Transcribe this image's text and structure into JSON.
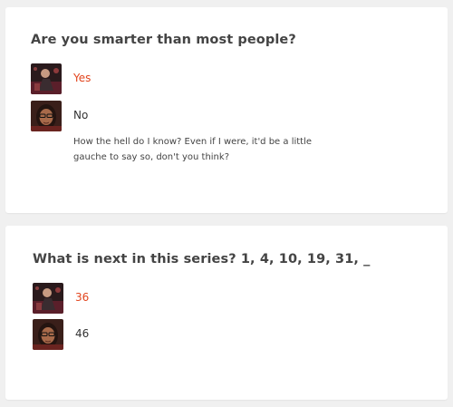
{
  "questions": [
    {
      "question": "Are you smarter than most people?",
      "answers": [
        {
          "avatar": "performer-avatar-icon",
          "text": "Yes",
          "selected": true
        },
        {
          "avatar": "woman-glasses-avatar-icon",
          "text": "No",
          "selected": false
        }
      ],
      "comment": "How the hell do I know? Even if I were, it'd be a little gauche to say so, don't you think?"
    },
    {
      "question": "What is next in this series? 1, 4, 10, 19, 31, _",
      "answers": [
        {
          "avatar": "performer-avatar-icon",
          "text": "36",
          "selected": true
        },
        {
          "avatar": "woman-glasses-avatar-icon",
          "text": "46",
          "selected": false
        }
      ]
    }
  ],
  "colors": {
    "selected_answer": "#e2461f",
    "question_text": "#444444",
    "card_background": "#ffffff",
    "page_background": "#f0f0f0"
  }
}
